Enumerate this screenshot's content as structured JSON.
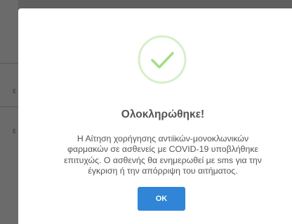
{
  "background": {
    "fragments": [
      "ε",
      "ε"
    ]
  },
  "modal": {
    "icon": "success-check-icon",
    "title": "Ολοκληρώθηκε!",
    "message": "Η Αίτηση χορήγησης αντιϊκών-μονοκλωνικών φαρμακών σε ασθενείς με COVID-19 υποβλήθηκε επιτυχώς. Ο ασθενής θα ενημερωθεί με sms για την έγκριση ή την απόρριψη του αιτήματος.",
    "ok_label": "OK"
  },
  "colors": {
    "overlay": "#5f5f5f",
    "success": "#a5dc86",
    "success_ring": "#d6efc8",
    "button": "#3085d6",
    "text": "#545454"
  }
}
